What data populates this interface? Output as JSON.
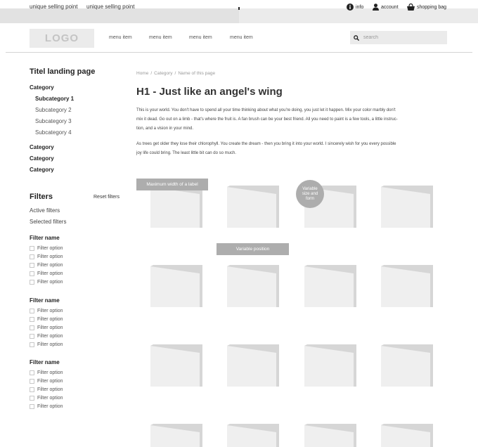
{
  "usp_bar": {
    "items": [
      "unique selling point",
      "unique selling point"
    ]
  },
  "utility_nav": {
    "info": "info",
    "account": "account",
    "bag": "shopping bag"
  },
  "header": {
    "logo": "LOGO",
    "menu": [
      "menu item",
      "menu item",
      "menu item",
      "menu item"
    ],
    "search_placeholder": "search"
  },
  "sidebar": {
    "title": "Titel landing page",
    "categories_top": "Category",
    "subcategories": [
      "Subcategory 1",
      "Subcategory 2",
      "Subcategory 3",
      "Subcategory 4"
    ],
    "categories_bottom": [
      "Category",
      "Category",
      "Category"
    ],
    "filters_title": "Filters",
    "reset": "Reset filters",
    "active": "Active filters",
    "selected": "Selected filters",
    "filter_groups": [
      {
        "name": "Filter name",
        "options": [
          "Filter option",
          "Filter option",
          "Filter option",
          "Filter option",
          "Filter option"
        ]
      },
      {
        "name": "Filter name",
        "options": [
          "Filter option",
          "Filter option",
          "Filter option",
          "Filter option",
          "Filter option"
        ]
      },
      {
        "name": "Filter name",
        "options": [
          "Filter option",
          "Filter option",
          "Filter option",
          "Filter option",
          "Filter option"
        ]
      }
    ]
  },
  "main": {
    "breadcrumb": [
      "Home",
      "/",
      "Category",
      "/",
      "Name of this page"
    ],
    "h1": "H1 - Just like an angel's wing",
    "paragraph_1_lines": [
      "This is your world. You don't have to spend all your time thinking about what you're doing, you just let it happen. Mix your color marbly don't",
      "mix it dead. Go out on a limb - that's where the fruit is. A fan brush can be your best friend. All you need to paint is a few tools, a little instruc-",
      "tion, and a vision in your mind."
    ],
    "paragraph_2_lines": [
      "As trees get older they lose their chlorophyll. You create the dream - then you bring it into your world. I sincerely wish for you every possible",
      "joy life could bring. The least little bit can do so much."
    ],
    "label_max_width": "Maximum width of a label",
    "label_variable_position": "Variable position",
    "badge_lines": [
      "Variable",
      "size and",
      "form"
    ]
  },
  "colors": {
    "usp_bar": "#ebebeb",
    "tag_gray": "#adadad",
    "card_light": "#efefef",
    "card_shadow": "#d6d6d6"
  }
}
